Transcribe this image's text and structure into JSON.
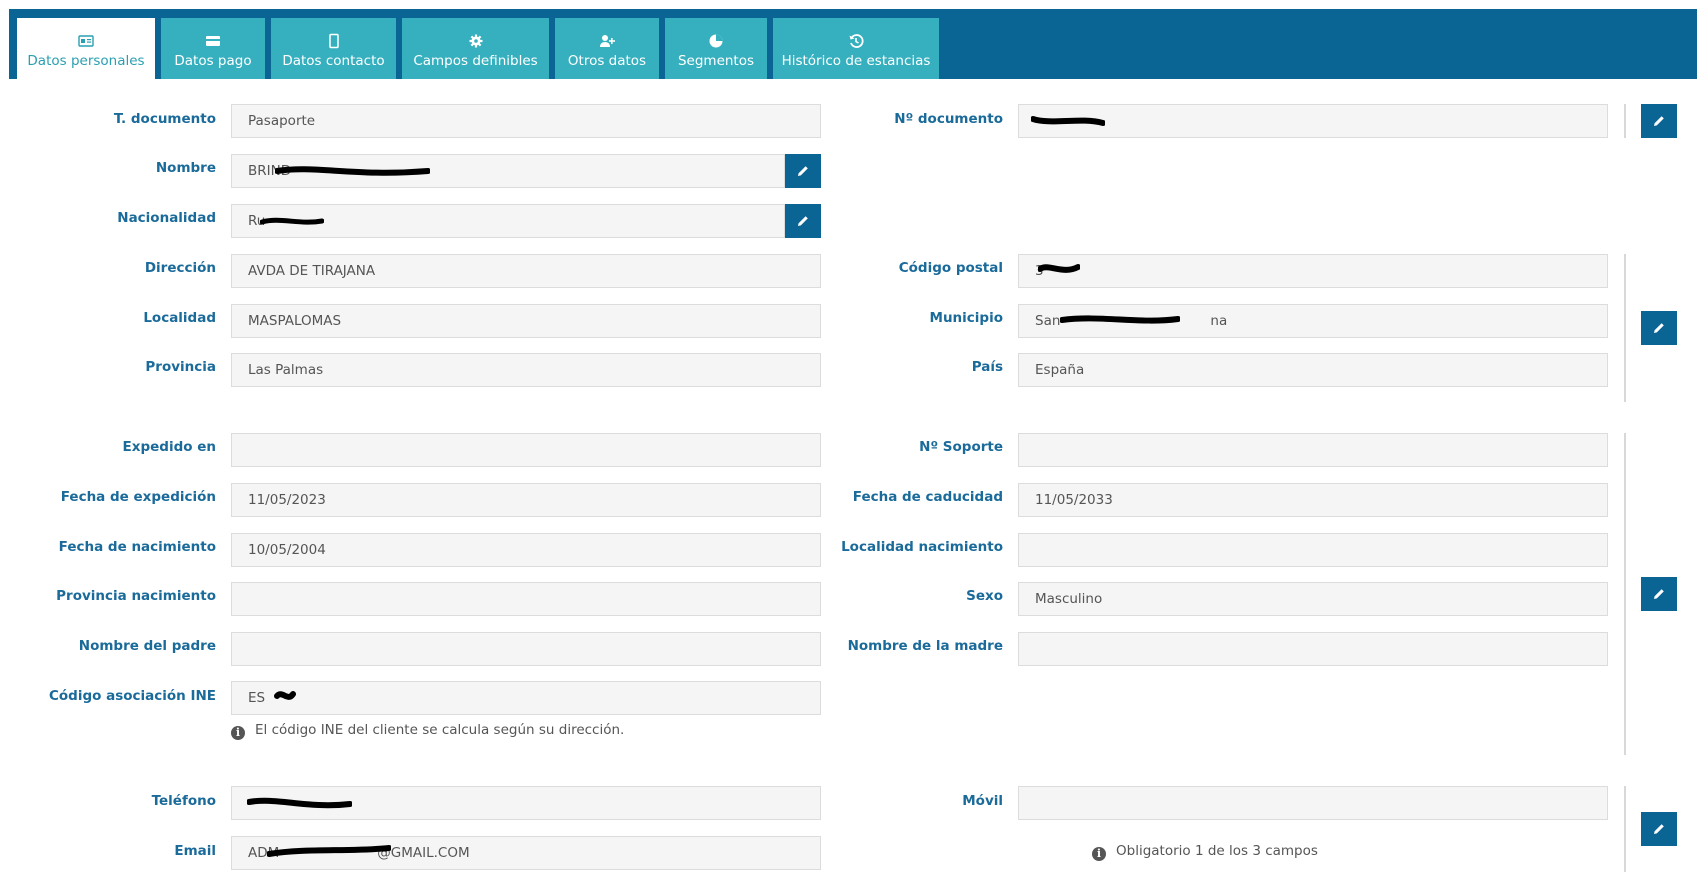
{
  "tabs": [
    {
      "label": "Datos personales",
      "icon": "id-card-icon",
      "active": true
    },
    {
      "label": "Datos pago",
      "icon": "credit-card-icon"
    },
    {
      "label": "Datos contacto",
      "icon": "mobile-icon"
    },
    {
      "label": "Campos definibles",
      "icon": "gear-icon"
    },
    {
      "label": "Otros datos",
      "icon": "user-plus-icon"
    },
    {
      "label": "Segmentos",
      "icon": "pie-chart-icon"
    },
    {
      "label": "Histórico de estancias",
      "icon": "history-icon"
    }
  ],
  "colors": {
    "header": "#0a6494",
    "tab": "#36b0bf",
    "label": "#1a6a9a",
    "button": "#0a6494"
  },
  "left": {
    "t_documento": {
      "label": "T. documento",
      "value": "Pasaporte"
    },
    "nombre": {
      "label": "Nombre",
      "value": "BRIND"
    },
    "nacionalidad": {
      "label": "Nacionalidad",
      "value": "Ru"
    },
    "direccion": {
      "label": "Dirección",
      "value": "AVDA DE TIRAJANA"
    },
    "localidad": {
      "label": "Localidad",
      "value": "MASPALOMAS"
    },
    "provincia": {
      "label": "Provincia",
      "value": "Las Palmas"
    },
    "expedido_en": {
      "label": "Expedido en",
      "value": ""
    },
    "fecha_expedicion": {
      "label": "Fecha de expedición",
      "value": "11/05/2023"
    },
    "fecha_nacimiento": {
      "label": "Fecha de nacimiento",
      "value": "10/05/2004"
    },
    "provincia_nacimiento": {
      "label": "Provincia nacimiento",
      "value": ""
    },
    "nombre_padre": {
      "label": "Nombre del padre",
      "value": ""
    },
    "codigo_ine": {
      "label": "Código asociación INE",
      "value": "ES"
    },
    "ine_note": "El código INE del cliente se calcula según su dirección.",
    "telefono": {
      "label": "Teléfono",
      "value": ""
    },
    "email": {
      "label": "Email",
      "value": "ADM",
      "value_tail": "@GMAIL.COM"
    }
  },
  "right": {
    "n_documento": {
      "label": "Nº documento",
      "value": ""
    },
    "codigo_postal": {
      "label": "Código postal",
      "value": "3"
    },
    "municipio": {
      "label": "Municipio",
      "value": "San",
      "value_tail": "na"
    },
    "pais": {
      "label": "País",
      "value": "España"
    },
    "n_soporte": {
      "label": "Nº Soporte",
      "value": ""
    },
    "fecha_caducidad": {
      "label": "Fecha de caducidad",
      "value": "11/05/2033"
    },
    "localidad_nacimiento": {
      "label": "Localidad nacimiento",
      "value": ""
    },
    "sexo": {
      "label": "Sexo",
      "value": "Masculino"
    },
    "nombre_madre": {
      "label": "Nombre de la madre",
      "value": ""
    },
    "movil": {
      "label": "Móvil",
      "value": ""
    },
    "obligatorio_note": "Obligatorio 1 de los 3 campos"
  }
}
